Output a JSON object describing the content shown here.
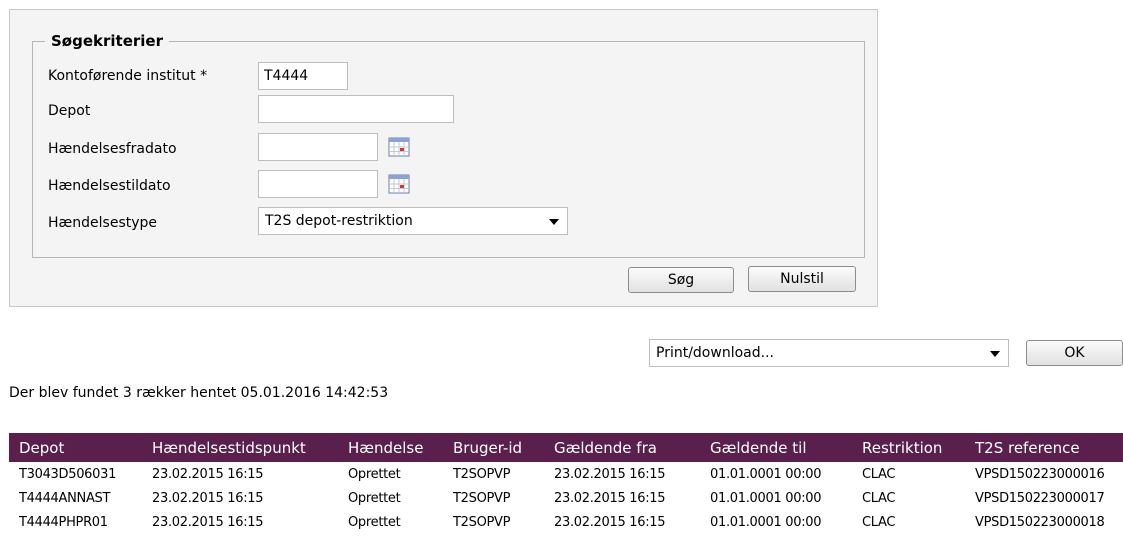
{
  "search": {
    "legend": "Søgekriterier",
    "fields": {
      "institute": {
        "label": "Kontoførende institut *",
        "value": "T4444"
      },
      "depot": {
        "label": "Depot",
        "value": ""
      },
      "from_date": {
        "label": "Hændelsesfradato",
        "value": ""
      },
      "to_date": {
        "label": "Hændelsestildato",
        "value": ""
      },
      "event_type": {
        "label": "Hændelsestype",
        "value": "T2S depot-restriktion"
      }
    },
    "buttons": {
      "search": "Søg",
      "reset": "Nulstil"
    }
  },
  "print": {
    "selected": "Print/download...",
    "ok": "OK"
  },
  "status_text": "Der blev fundet 3 rækker hentet 05.01.2016 14:42:53",
  "table": {
    "header_color": "#5a1f4d",
    "columns": [
      "Depot",
      "Hændelsestidspunkt",
      "Hændelse",
      "Bruger-id",
      "Gældende fra",
      "Gældende til",
      "Restriktion",
      "T2S reference"
    ],
    "rows": [
      [
        "T3043D506031",
        "23.02.2015 16:15",
        "Oprettet",
        "T2SOPVP",
        "23.02.2015 16:15",
        "01.01.0001 00:00",
        "CLAC",
        "VPSD150223000016"
      ],
      [
        "T4444ANNAST",
        "23.02.2015 16:15",
        "Oprettet",
        "T2SOPVP",
        "23.02.2015 16:15",
        "01.01.0001 00:00",
        "CLAC",
        "VPSD150223000017"
      ],
      [
        "T4444PHPR01",
        "23.02.2015 16:15",
        "Oprettet",
        "T2SOPVP",
        "23.02.2015 16:15",
        "01.01.0001 00:00",
        "CLAC",
        "VPSD150223000018"
      ]
    ]
  },
  "icons": {
    "calendar": "calendar-icon",
    "dropdown": "chevron-down-icon"
  }
}
